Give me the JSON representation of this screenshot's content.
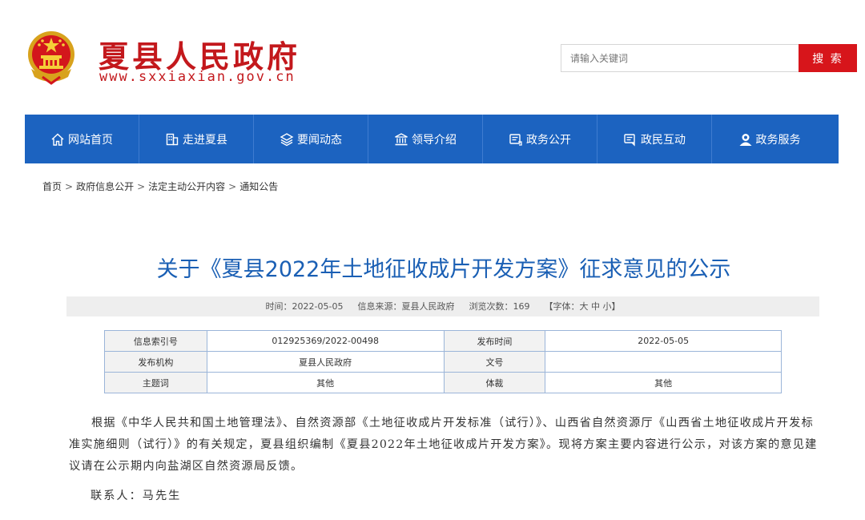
{
  "header": {
    "site_title": "夏县人民政府",
    "site_url": "www.sxxiaxian.gov.cn",
    "search_placeholder": "请输入关键词",
    "search_button": "搜 索"
  },
  "nav": {
    "items": [
      {
        "label": "网站首页",
        "icon": "home-icon"
      },
      {
        "label": "走进夏县",
        "icon": "building-icon"
      },
      {
        "label": "要闻动态",
        "icon": "layers-icon"
      },
      {
        "label": "领导介绍",
        "icon": "institution-icon"
      },
      {
        "label": "政务公开",
        "icon": "document-icon"
      },
      {
        "label": "政民互动",
        "icon": "chat-document-icon"
      },
      {
        "label": "政务服务",
        "icon": "user-service-icon"
      }
    ]
  },
  "breadcrumb": [
    "首页",
    "政府信息公开",
    "法定主动公开内容",
    "通知公告"
  ],
  "breadcrumb_sep": ">",
  "article": {
    "title": "关于《夏县2022年土地征收成片开发方案》征求意见的公示",
    "meta_time": "时间：2022-05-05",
    "meta_source": "信息来源：夏县人民政府",
    "meta_views": "浏览次数：169",
    "meta_font_prefix": "【字体：",
    "meta_font_large": "大",
    "meta_font_medium": "中",
    "meta_font_small": "小",
    "meta_font_suffix": "】",
    "paragraph": "根据《中华人民共和国土地管理法》、自然资源部《土地征收成片开发标准（试行）》、山西省自然资源厅《山西省土地征收成片开发标准实施细则（试行）》的有关规定，夏县组织编制《夏县2022年土地征收成片开发方案》。现将方案主要内容进行公示，对该方案的意见建议请在公示期内向盐湖区自然资源局反馈。",
    "contact": "联系人：马先生"
  },
  "info_table": {
    "index_label": "信息索引号",
    "index_value": "012925369/2022-00498",
    "date_label": "发布时间",
    "date_value": "2022-05-05",
    "org_label": "发布机构",
    "org_value": "夏县人民政府",
    "doc_label": "文号",
    "doc_value": "",
    "topic_label": "主题词",
    "topic_value": "其他",
    "genre_label": "体裁",
    "genre_value": "其他"
  },
  "colors": {
    "brand_red": "#c3181c",
    "nav_blue": "#1c63c0",
    "title_blue": "#1a5fb4"
  }
}
